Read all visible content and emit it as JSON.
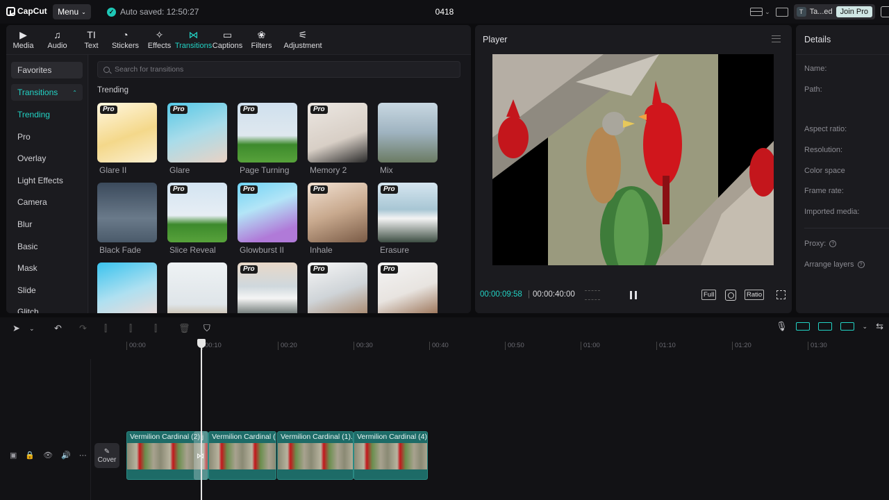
{
  "app": {
    "logo": "CapCut",
    "menu_label": "Menu",
    "autosave": "Auto saved: 12:50:27",
    "project_title": "0418",
    "user_initial": "T",
    "user_name": "Ta...ed",
    "join_pro": "Join Pro"
  },
  "tools": [
    {
      "label": "Media",
      "icon": "media-icon",
      "glyph": "▶"
    },
    {
      "label": "Audio",
      "icon": "audio-icon",
      "glyph": "♫"
    },
    {
      "label": "Text",
      "icon": "text-icon",
      "glyph": "TI"
    },
    {
      "label": "Stickers",
      "icon": "stickers-icon",
      "glyph": "◔"
    },
    {
      "label": "Effects",
      "icon": "effects-icon",
      "glyph": "✧"
    },
    {
      "label": "Transitions",
      "icon": "transitions-icon",
      "glyph": "⋈"
    },
    {
      "label": "Captions",
      "icon": "captions-icon",
      "glyph": "▭"
    },
    {
      "label": "Filters",
      "icon": "filters-icon",
      "glyph": "❀"
    },
    {
      "label": "Adjustment",
      "icon": "adjustment-icon",
      "glyph": "⚟"
    }
  ],
  "sidebar": {
    "favorites": "Favorites",
    "category": "Transitions",
    "items": [
      "Trending",
      "Pro",
      "Overlay",
      "Light Effects",
      "Camera",
      "Blur",
      "Basic",
      "Mask",
      "Slide",
      "Glitch"
    ]
  },
  "search": {
    "placeholder": "Search for transitions"
  },
  "section_title": "Trending",
  "pro_badge": "Pro",
  "cards": [
    {
      "label": "Glare II",
      "pro": true
    },
    {
      "label": "Glare",
      "pro": true
    },
    {
      "label": "Page Turning",
      "pro": true
    },
    {
      "label": "Memory 2",
      "pro": true
    },
    {
      "label": "Mix",
      "pro": false
    },
    {
      "label": "Black Fade",
      "pro": false
    },
    {
      "label": "Slice Reveal",
      "pro": true
    },
    {
      "label": "Glowburst II",
      "pro": true
    },
    {
      "label": "Inhale",
      "pro": true
    },
    {
      "label": "Erasure",
      "pro": true
    },
    {
      "label": "",
      "pro": false
    },
    {
      "label": "",
      "pro": false
    },
    {
      "label": "",
      "pro": true
    },
    {
      "label": "",
      "pro": true
    },
    {
      "label": "",
      "pro": true
    }
  ],
  "player": {
    "title": "Player",
    "time_current": "00:00:09:58",
    "time_sep": "|",
    "time_total": "00:00:40:00",
    "full": "Full",
    "ratio": "Ratio"
  },
  "details": {
    "title": "Details",
    "fields": [
      "Name:",
      "Path:",
      "Aspect ratio:",
      "Resolution:",
      "Color space",
      "Frame rate:",
      "Imported media:"
    ],
    "proxy": "Proxy:",
    "arrange": "Arrange layers"
  },
  "timeline": {
    "ticks": [
      "00:00",
      "00:10",
      "00:20",
      "00:30",
      "00:40",
      "00:50",
      "01:00",
      "01:10",
      "01:20",
      "01:30"
    ],
    "cover_label": "Cover",
    "clips": [
      {
        "label": "Vermilion Cardinal (2).j"
      },
      {
        "label": "Vermilion Cardinal (3"
      },
      {
        "label": "Vermilion Cardinal (1).j"
      },
      {
        "label": "Vermilion Cardinal (4).j"
      }
    ]
  }
}
